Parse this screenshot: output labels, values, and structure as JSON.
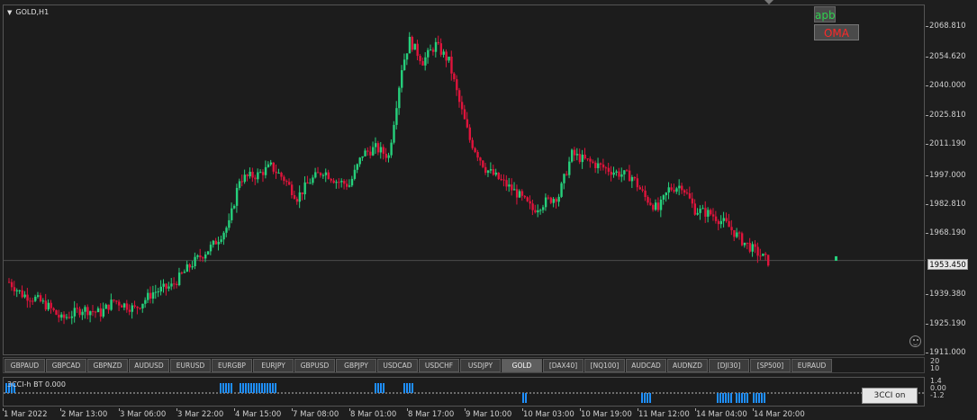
{
  "chart": {
    "symbol": "GOLD,H1",
    "current_price": "1953.450",
    "price_labels": [
      "2068.810",
      "2054.620",
      "2040.000",
      "2025.810",
      "2011.190",
      "1997.000",
      "1982.810",
      "1968.190",
      "1939.380",
      "1925.190",
      "1911.000"
    ],
    "price_min": 1911.0,
    "price_max": 2068.81,
    "time_labels": [
      "1 Mar 2022",
      "2 Mar 13:00",
      "3 Mar 06:00",
      "3 Mar 22:00",
      "4 Mar 15:00",
      "7 Mar 08:00",
      "8 Mar 01:00",
      "8 Mar 17:00",
      "9 Mar 10:00",
      "10 Mar 03:00",
      "10 Mar 19:00",
      "11 Mar 12:00",
      "14 Mar 04:00",
      "14 Mar 20:00"
    ],
    "colors": {
      "bull": "#26d07c",
      "bear": "#e0143c",
      "background": "#1c1c1c",
      "grid": "#555555",
      "bid_line": "#4a4a4a"
    }
  },
  "overlay_buttons": {
    "apb": "apb",
    "oma": "OMA"
  },
  "symbol_bar": {
    "items": [
      "GBPAUD",
      "GBPCAD",
      "GBPNZD",
      "AUDUSD",
      "EURUSD",
      "EURGBP",
      "EURJPY",
      "GBPUSD",
      "GBPJPY",
      "USDCAD",
      "USDCHF",
      "USDJPY",
      "GOLD",
      "[DAX40]",
      "[NQ100]",
      "AUDCAD",
      "AUDNZD",
      "[DJI30]",
      "[SP500]",
      "EURAUD"
    ],
    "active": "GOLD"
  },
  "sub_window_scale": [
    "20",
    "10"
  ],
  "indicator": {
    "label": "3CCI-h BT 0.000",
    "scale": [
      "1.4",
      "0.00",
      "-1.2"
    ],
    "button": "3CCI on",
    "color": "#1e8fff"
  }
}
